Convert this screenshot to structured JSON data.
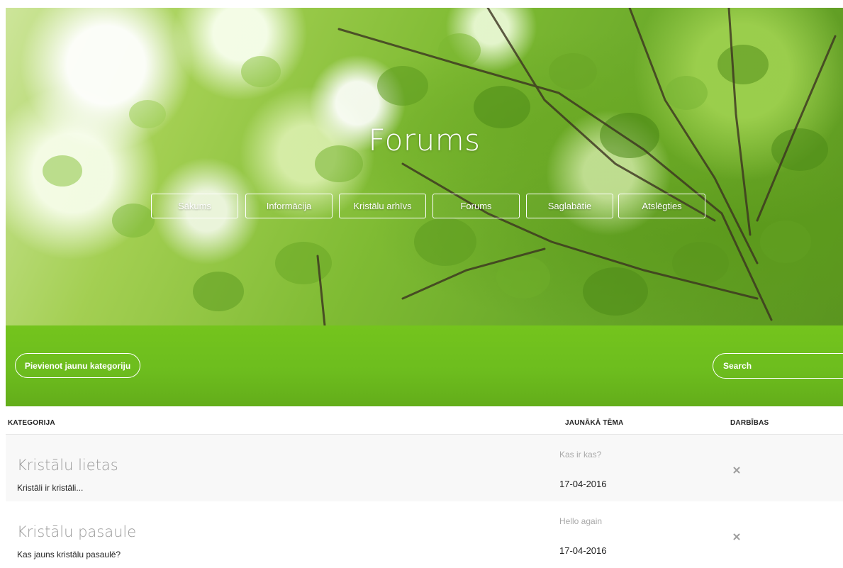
{
  "hero": {
    "title": "Forums"
  },
  "nav": {
    "items": [
      {
        "label": "Sākums"
      },
      {
        "label": "Informācija"
      },
      {
        "label": "Kristālu arhīvs"
      },
      {
        "label": "Forums"
      },
      {
        "label": "Saglabātie"
      },
      {
        "label": "Atslēgties"
      }
    ]
  },
  "toolbar": {
    "add_category_label": "Pievienot jaunu kategoriju",
    "search_placeholder": "Search",
    "bar_color": "#6dbd1e"
  },
  "table": {
    "columns": {
      "category": "KATEGORIJA",
      "latest_topic": "JAUNĀKĀ TĒMA",
      "actions": "DARBĪBAS"
    },
    "rows": [
      {
        "title": "Kristālu lietas",
        "description": "Kristāli ir kristāli...",
        "latest_topic": "Kas ir kas?",
        "latest_date": "17-04-2016",
        "action_icon": "close-icon"
      },
      {
        "title": "Kristālu pasaule",
        "description": "Kas jauns kristālu pasaulē?",
        "latest_topic": "Hello again",
        "latest_date": "17-04-2016",
        "action_icon": "close-icon"
      }
    ]
  }
}
